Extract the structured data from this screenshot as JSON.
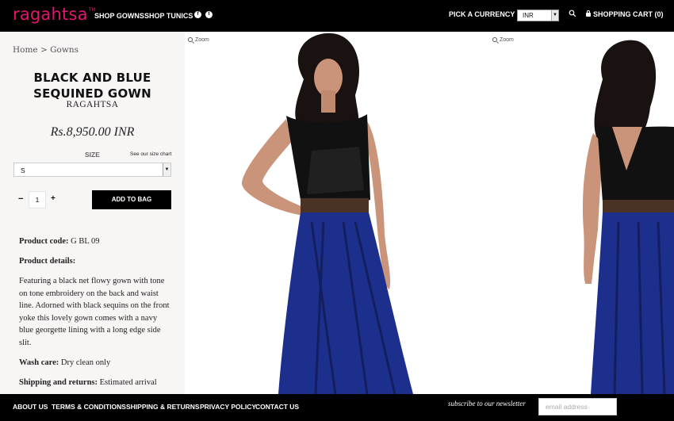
{
  "header": {
    "logo": "ragahtsa",
    "logo_tm": "TM",
    "nav": [
      "SHOP GOWNS",
      "SHOP TUNICS"
    ],
    "social": [
      "facebook-icon",
      "twitter-icon"
    ],
    "currency_label": "PICK A CURRENCY",
    "currency_value": "INR",
    "cart_label": "SHOPPING CART (0)"
  },
  "product": {
    "breadcrumb": "Home > Gowns",
    "title": "BLACK AND BLUE SEQUINED GOWN",
    "brand": "RAGAHTSA",
    "price": "Rs.8,950.00 INR",
    "size_label": "SIZE",
    "size_chart_link": "See our size chart",
    "size_value": "S",
    "qty_minus": "−",
    "qty_value": "1",
    "qty_plus": "+",
    "add_to_bag": "ADD TO BAG",
    "code_label": "Product code:",
    "code_value": "G BL 09",
    "details_label": "Product details:",
    "description": "Featuring a black net flowy gown with tone on tone embroidery on the back and waist line. Adorned with black sequins on the front yoke this lovely gown comes with a navy blue georgette lining with a long edge side slit.",
    "wash_label": "Wash care:",
    "wash_value": "Dry clean only",
    "shipping_label": "Shipping and returns:",
    "shipping_value": "Estimated arrival"
  },
  "gallery": {
    "zoom_label": "Zoom"
  },
  "footer": {
    "links": [
      "ABOUT US",
      "TERMS & CONDITIONS",
      "SHIPPING & RETURNS",
      "PRIVACY POLICY",
      "CONTACT US"
    ],
    "newsletter_label": "subscribe to our newsletter",
    "email_placeholder": "email address"
  },
  "colors": {
    "brand_pink": "#e3166f",
    "bar_black": "#000000",
    "panel_bg": "#f8f5f5"
  }
}
